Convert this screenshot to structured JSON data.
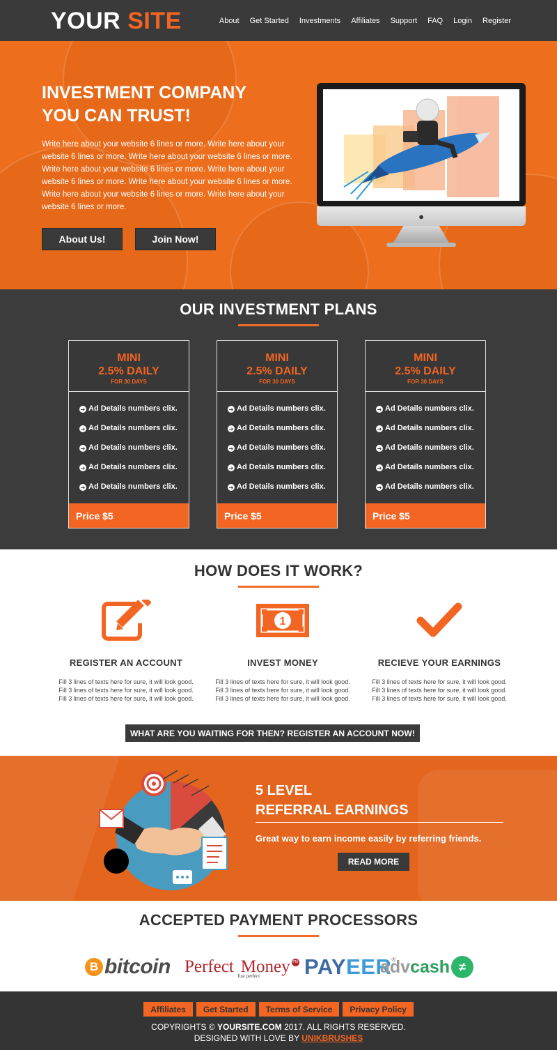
{
  "header": {
    "logo_primary": "YOUR",
    "logo_accent": "SITE",
    "nav": [
      "About",
      "Get Started",
      "Investments",
      "Affiliates",
      "Support",
      "FAQ",
      "Login",
      "Register"
    ]
  },
  "hero": {
    "title_line1": "INVESTMENT COMPANY",
    "title_line2": "YOU CAN TRUST!",
    "text": "Write here about your website 6 lines or more. Write here about your website 6 lines or more. Write here about your website 6 lines or more. Write here about your website 6 lines or more. Write here about your website 6 lines or more. Write here about your website 6 lines or more. Write here about your website 6 lines or more. Write here about your website 6 lines or more.",
    "about_button": "About Us!",
    "join_button": "Join Now!"
  },
  "plans": {
    "title": "OUR INVESTMENT PLANS",
    "items": [
      {
        "name": "MINI",
        "rate": "2.5% DAILY",
        "days": "FOR 30 DAYS",
        "features": [
          "Ad Details numbers clix.",
          "Ad Details numbers clix.",
          "Ad Details numbers clix.",
          "Ad Details numbers clix.",
          "Ad Details numbers clix."
        ],
        "price": "Price $5"
      },
      {
        "name": "MINI",
        "rate": "2.5% DAILY",
        "days": "FOR 30 DAYS",
        "features": [
          "Ad Details numbers clix.",
          "Ad Details numbers clix.",
          "Ad Details numbers clix.",
          "Ad Details numbers clix.",
          "Ad Details numbers clix."
        ],
        "price": "Price $5"
      },
      {
        "name": "MINI",
        "rate": "2.5% DAILY",
        "days": "FOR 30 DAYS",
        "features": [
          "Ad Details numbers clix.",
          "Ad Details numbers clix.",
          "Ad Details numbers clix.",
          "Ad Details numbers clix.",
          "Ad Details numbers clix."
        ],
        "price": "Price $5"
      }
    ]
  },
  "how": {
    "title": "HOW DOES IT WORK?",
    "steps": [
      {
        "icon": "edit-icon",
        "title": "REGISTER AN ACCOUNT",
        "text": "Fill 3 lines of texts here for sure, it will look good. Fill 3 lines of texts here for sure, it will look good. Fill 3 lines of texts here for sure, it will look good."
      },
      {
        "icon": "money-icon",
        "title": "INVEST MONEY",
        "text": "Fill 3 lines of texts here for sure, it will look good. Fill 3 lines of texts here for sure, it will look good. Fill 3 lines of texts here for sure, it will look good."
      },
      {
        "icon": "check-icon",
        "title": "RECIEVE YOUR EARNINGS",
        "text": "Fill 3 lines of texts here for sure, it will look good. Fill 3 lines of texts here for sure, it will look good. Fill 3 lines of texts here for sure, it will look good."
      }
    ],
    "cta": "WHAT ARE YOU WAITING FOR THEN? REGISTER AN ACCOUNT NOW!"
  },
  "referral": {
    "title_line1": "5 LEVEL",
    "title_line2": "REFERRAL EARNINGS",
    "text": "Great way to earn income easily by referring friends.",
    "button": "READ MORE"
  },
  "payments": {
    "title": "ACCEPTED PAYMENT PROCESSORS",
    "bitcoin_symbol": "B",
    "bitcoin": "bitcoin",
    "pm_word1": "Perfect",
    "pm_word2": "Money",
    "pm_sub": "Just perfect",
    "pm_badge": "PM",
    "payeer_a": "PAY",
    "payeer_b": "EER",
    "payeer_reg": "®",
    "adv_a": "adv",
    "adv_b": "cash",
    "adv_symbol": "≠"
  },
  "footer": {
    "links": [
      "Affiliates",
      "Get Started",
      "Terms of Service",
      "Privacy Policy"
    ],
    "copyright_prefix": "COPYRIGHTS ©",
    "copyright_site": "YOURSITE.COM",
    "copyright_suffix": "2017. ALL RIGHTS RESERVED.",
    "designed_prefix": "DESIGNED WITH LOVE BY",
    "designed_brand": "UNIKBRUSHES"
  },
  "colors": {
    "accent": "#f26522",
    "dark": "#3a3a3a"
  }
}
